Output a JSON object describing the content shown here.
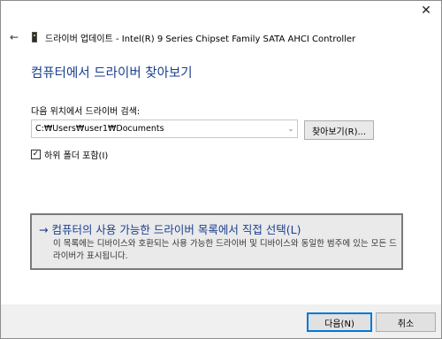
{
  "window": {
    "close_icon": "close-icon",
    "close_glyph": "✕"
  },
  "header": {
    "back_glyph": "←",
    "device_icon": "device-chip-icon",
    "title": "드라이버 업데이트 - Intel(R) 9 Series Chipset Family SATA AHCI Controller"
  },
  "main": {
    "heading": "컴퓨터에서 드라이버 찾아보기",
    "search_label": "다음 위치에서 드라이버 검색:",
    "path_value": "C:₩Users₩user1₩Documents",
    "browse_button": "찾아보기(R)...",
    "include_subfolders_label": "하위 폴더 포함(I)",
    "include_subfolders_checked": true
  },
  "pick_option": {
    "title": "→ 컴퓨터의 사용 가능한 드라이버 목록에서 직접 선택(L)",
    "description": "이 목록에는 디바이스와 호환되는 사용 가능한 드라이버 및 디바이스와 동일한 범주에 있는 모든 드라이버가 표시됩니다."
  },
  "footer": {
    "next_button": "다음(N)",
    "cancel_button": "취소"
  },
  "colors": {
    "accent": "#1a3f8f",
    "focus_border": "#0078d7"
  }
}
